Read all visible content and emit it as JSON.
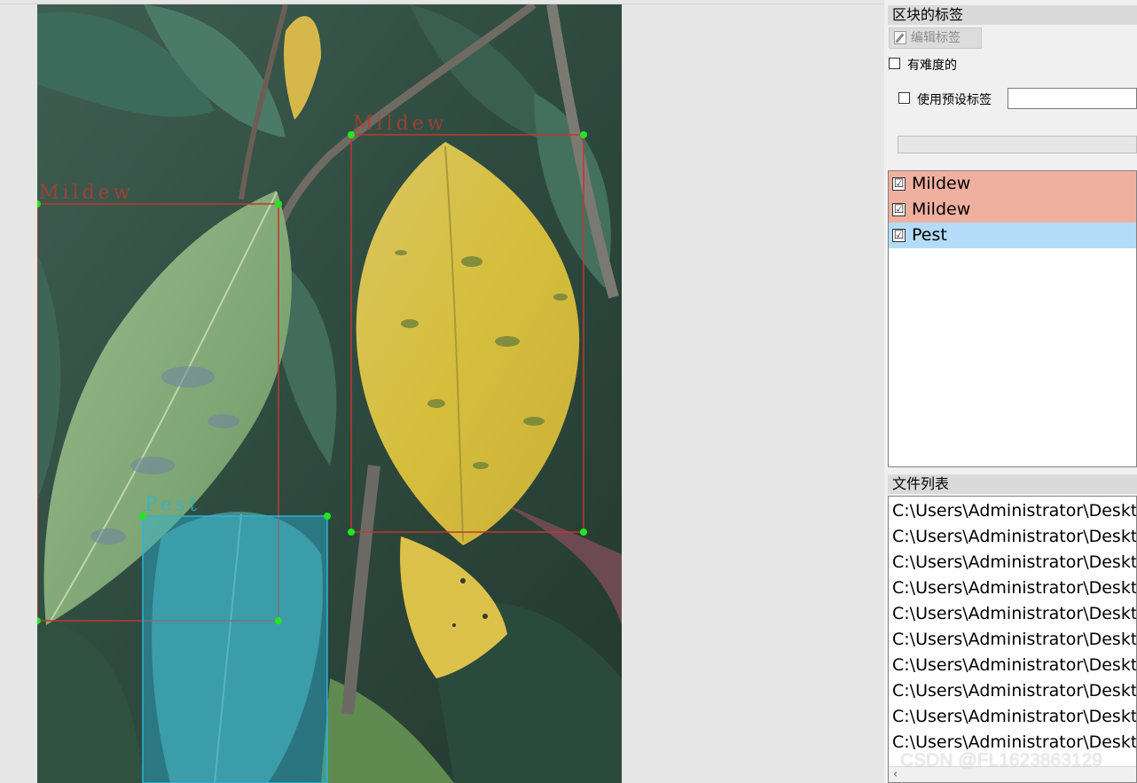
{
  "annotations": [
    {
      "label": "Mildew",
      "color": "#c0392b"
    },
    {
      "label": "Mildew",
      "color": "#c0392b"
    },
    {
      "label": "Pest",
      "color": "#2ab4d8"
    }
  ],
  "dock": {
    "box_labels_title": "区块的标签",
    "edit_label_button": "编辑标签",
    "difficult_checkbox": "有难度的",
    "use_default_label_checkbox": "使用预设标签",
    "default_label_value": ""
  },
  "label_list": [
    {
      "label": "Mildew",
      "checked": "☑",
      "bg": "#f0b0a0"
    },
    {
      "label": "Mildew",
      "checked": "☑",
      "bg": "#f0b0a0"
    },
    {
      "label": "Pest",
      "checked": "☑",
      "bg": "#b4dcf8"
    }
  ],
  "file_list_title": "文件列表",
  "file_list": [
    "C:\\Users\\Administrator\\Deskt",
    "C:\\Users\\Administrator\\Deskt",
    "C:\\Users\\Administrator\\Deskt",
    "C:\\Users\\Administrator\\Deskt",
    "C:\\Users\\Administrator\\Deskt",
    "C:\\Users\\Administrator\\Deskt",
    "C:\\Users\\Administrator\\Deskt",
    "C:\\Users\\Administrator\\Deskt",
    "C:\\Users\\Administrator\\Deskt",
    "C:\\Users\\Administrator\\Deskt"
  ],
  "watermark": "CSDN @FL1623863129",
  "scroll_left_icon": "‹"
}
